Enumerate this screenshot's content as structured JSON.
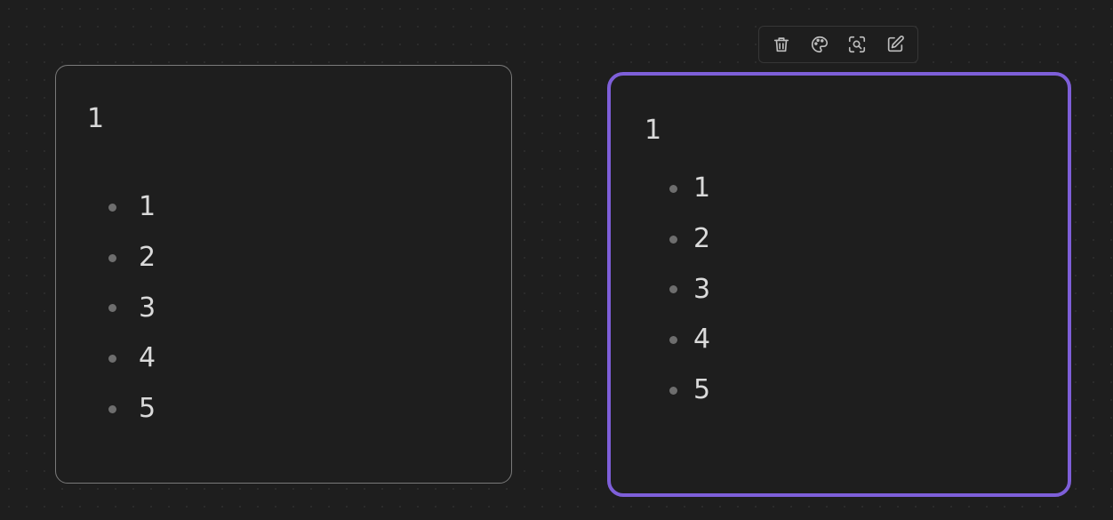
{
  "canvas": {
    "cards": [
      {
        "heading": "1",
        "items": [
          "1",
          "2",
          "3",
          "4",
          "5"
        ],
        "selected": false
      },
      {
        "heading": "1",
        "items": [
          "1",
          "2",
          "3",
          "4",
          "5"
        ],
        "selected": true
      }
    ],
    "selection_color": "#7e5fd9",
    "background_color": "#1e1e1e"
  },
  "toolbar": {
    "buttons": [
      {
        "icon": "trash-icon"
      },
      {
        "icon": "palette-icon"
      },
      {
        "icon": "zoom-to-selection-icon"
      },
      {
        "icon": "edit-icon"
      }
    ]
  }
}
